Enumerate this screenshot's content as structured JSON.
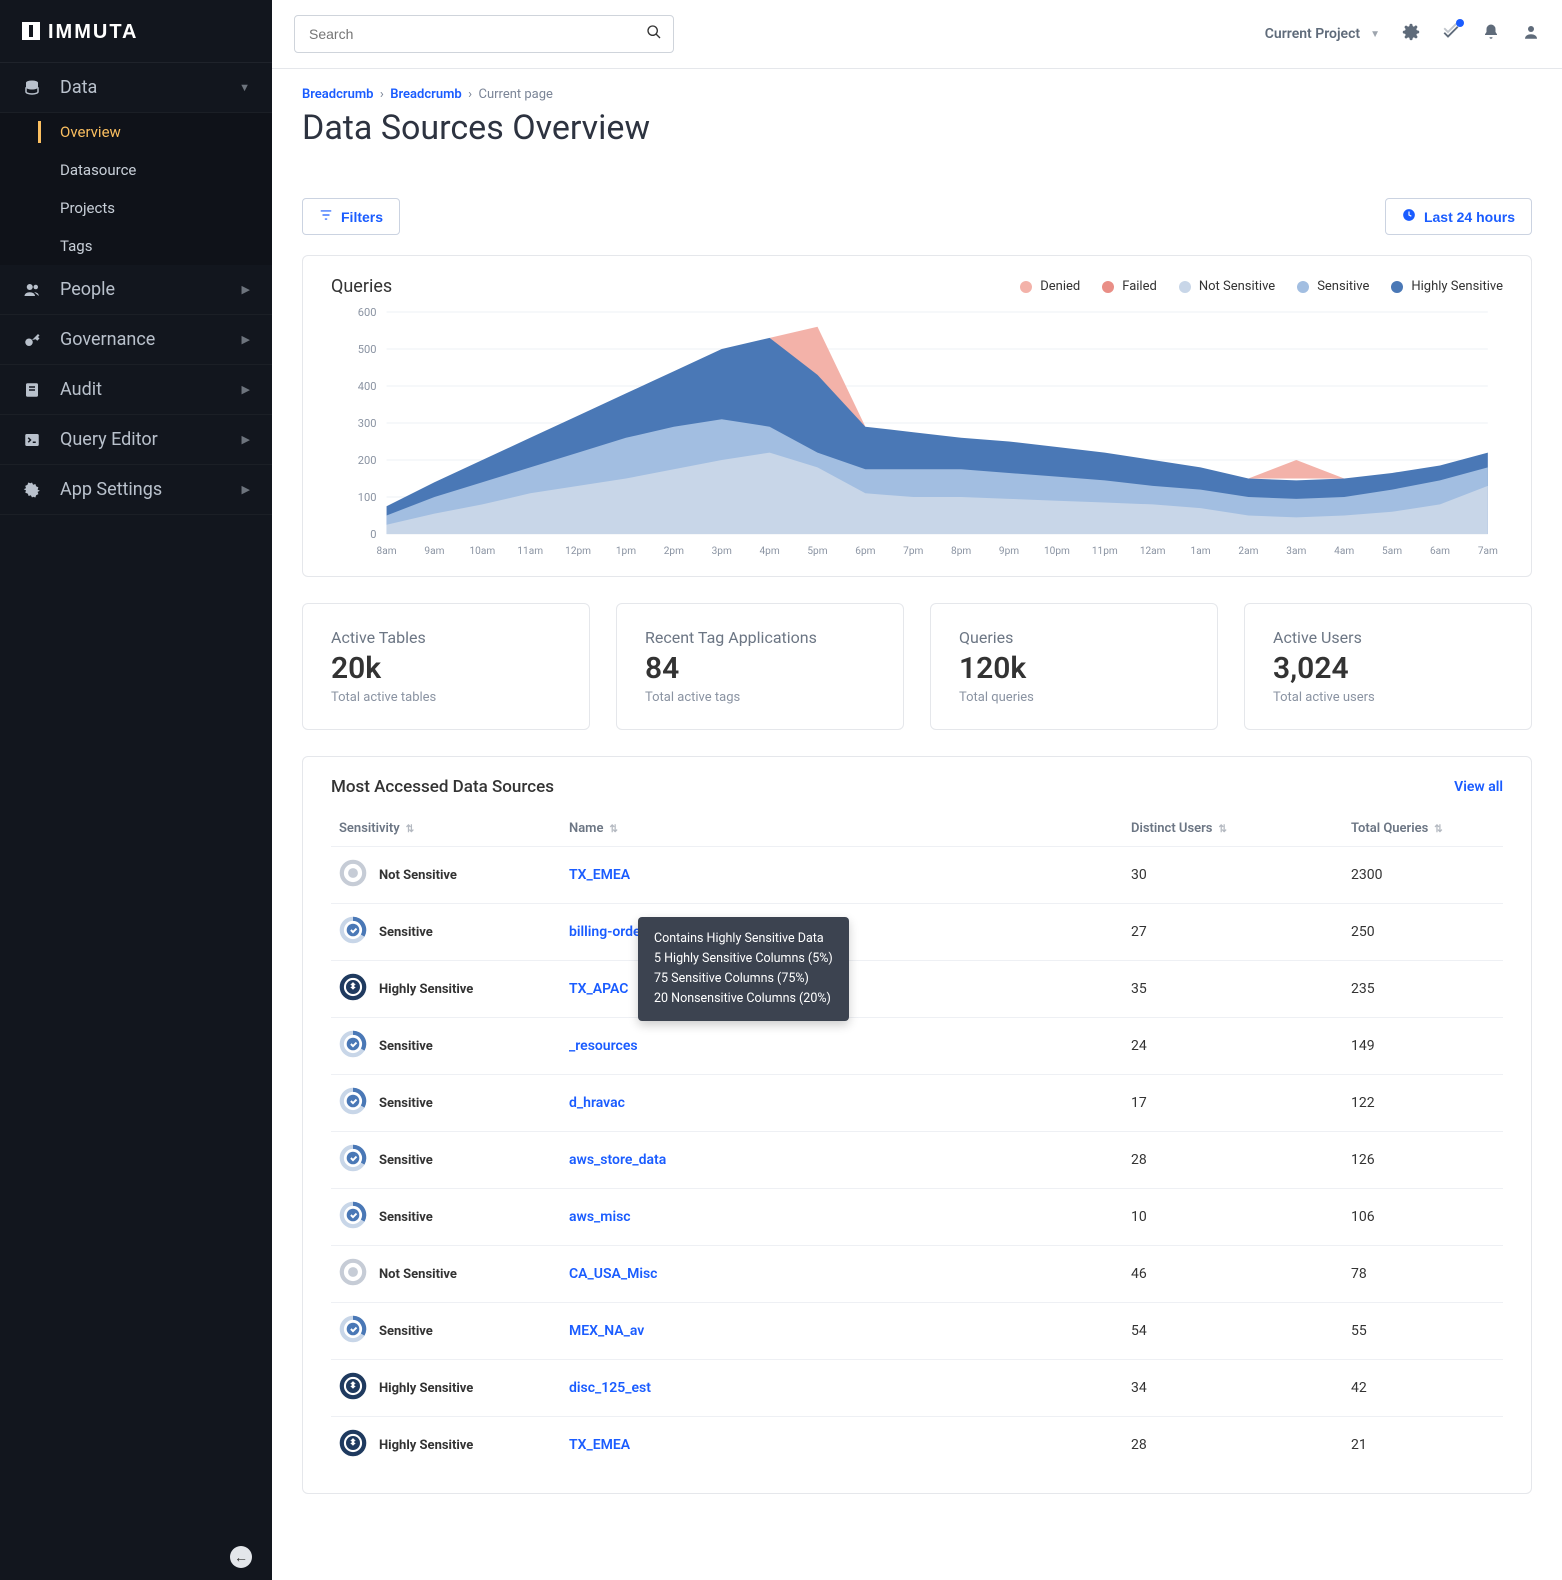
{
  "app_name": "IMMUTA",
  "search_placeholder": "Search",
  "topbar": {
    "project_label": "Current Project"
  },
  "sidebar": {
    "data": {
      "label": "Data",
      "items": [
        {
          "label": "Overview"
        },
        {
          "label": "Datasource"
        },
        {
          "label": "Projects"
        },
        {
          "label": "Tags"
        }
      ]
    },
    "people": {
      "label": "People"
    },
    "governance": {
      "label": "Governance"
    },
    "audit": {
      "label": "Audit"
    },
    "queryeditor": {
      "label": "Query Editor"
    },
    "appsettings": {
      "label": "App Settings"
    }
  },
  "breadcrumbs": {
    "a": "Breadcrumb",
    "b": "Breadcrumb",
    "c": "Current page"
  },
  "page_title": "Data Sources Overview",
  "toolbar": {
    "filters": "Filters",
    "timerange": "Last 24 hours"
  },
  "chart": {
    "title": "Queries",
    "legend": {
      "denied": "Denied",
      "failed": "Failed",
      "notsensitive": "Not Sensitive",
      "sensitive": "Sensitive",
      "highlysensitive": "Highly Sensitive"
    },
    "colors": {
      "denied": "#F3B2A9",
      "failed": "#E98E86",
      "notsensitive": "#C8D6E8",
      "sensitive": "#A2BEE1",
      "highlysensitive": "#4A78B6"
    }
  },
  "chart_data": {
    "type": "area",
    "title": "Queries",
    "ylabel": "",
    "ylim": [
      0,
      600
    ],
    "yticks": [
      0,
      100,
      200,
      300,
      400,
      500,
      600
    ],
    "categories": [
      "8am",
      "9am",
      "10am",
      "11am",
      "12pm",
      "1pm",
      "2pm",
      "3pm",
      "4pm",
      "5pm",
      "6pm",
      "7pm",
      "8pm",
      "9pm",
      "10pm",
      "11pm",
      "12am",
      "1am",
      "2am",
      "3am",
      "4am",
      "5am",
      "6am",
      "7am"
    ],
    "series": [
      {
        "name": "Not Sensitive",
        "color": "#C8D6E8",
        "values": [
          25,
          55,
          80,
          110,
          130,
          150,
          175,
          200,
          220,
          180,
          110,
          100,
          100,
          95,
          90,
          85,
          80,
          70,
          50,
          45,
          50,
          60,
          80,
          130
        ]
      },
      {
        "name": "Sensitive",
        "color": "#A2BEE1",
        "values": [
          50,
          100,
          140,
          180,
          220,
          260,
          290,
          310,
          290,
          220,
          175,
          175,
          175,
          165,
          155,
          145,
          130,
          120,
          100,
          95,
          100,
          120,
          145,
          180
        ]
      },
      {
        "name": "Highly Sensitive",
        "color": "#4A78B6",
        "values": [
          75,
          140,
          200,
          260,
          320,
          380,
          440,
          500,
          530,
          430,
          290,
          275,
          260,
          250,
          235,
          220,
          200,
          180,
          150,
          145,
          150,
          165,
          185,
          220
        ]
      },
      {
        "name": "Failed",
        "color": "#E98E86",
        "values": [
          0,
          0,
          0,
          0,
          0,
          0,
          0,
          0,
          530,
          560,
          290,
          0,
          0,
          0,
          0,
          0,
          0,
          0,
          165,
          200,
          165,
          0,
          0,
          0
        ],
        "peaks": [
          {
            "x": 9,
            "y": 560
          },
          {
            "x": 19,
            "y": 200
          }
        ]
      }
    ]
  },
  "stats": [
    {
      "title": "Active Tables",
      "value": "20k",
      "sub": "Total active tables"
    },
    {
      "title": "Recent Tag Applications",
      "value": "84",
      "sub": "Total active tags"
    },
    {
      "title": "Queries",
      "value": "120k",
      "sub": "Total queries"
    },
    {
      "title": "Active Users",
      "value": "3,024",
      "sub": "Total active users"
    }
  ],
  "table": {
    "title": "Most Accessed Data Sources",
    "viewall": "View all",
    "columns": {
      "sensitivity": "Sensitivity",
      "name": "Name",
      "users": "Distinct Users",
      "queries": "Total Queries"
    },
    "rows": [
      {
        "sens": "Not Sensitive",
        "kind": "none",
        "name": "TX_EMEA",
        "users": 30,
        "queries": 2300
      },
      {
        "sens": "Sensitive",
        "kind": "sens",
        "name": "billing-orders",
        "users": 27,
        "queries": 250
      },
      {
        "sens": "Highly Sensitive",
        "kind": "high",
        "name": "TX_APAC",
        "users": 35,
        "queries": 235
      },
      {
        "sens": "Sensitive",
        "kind": "sens",
        "name": "_resources",
        "users": 24,
        "queries": 149
      },
      {
        "sens": "Sensitive",
        "kind": "sens",
        "name": "d_hravac",
        "users": 17,
        "queries": 122
      },
      {
        "sens": "Sensitive",
        "kind": "sens",
        "name": "aws_store_data",
        "users": 28,
        "queries": 126
      },
      {
        "sens": "Sensitive",
        "kind": "sens",
        "name": "aws_misc",
        "users": 10,
        "queries": 106
      },
      {
        "sens": "Not Sensitive",
        "kind": "none",
        "name": "CA_USA_Misc",
        "users": 46,
        "queries": 78
      },
      {
        "sens": "Sensitive",
        "kind": "sens",
        "name": "MEX_NA_av",
        "users": 54,
        "queries": 55
      },
      {
        "sens": "Highly Sensitive",
        "kind": "high",
        "name": "disc_125_est",
        "users": 34,
        "queries": 42
      },
      {
        "sens": "Highly Sensitive",
        "kind": "high",
        "name": "TX_EMEA",
        "users": 28,
        "queries": 21
      }
    ]
  },
  "tooltip": {
    "lines": [
      "Contains Highly Sensitive Data",
      "5 Highly Sensitive Columns (5%)",
      "75 Sensitive Columns (75%)",
      "20 Nonsensitive Columns (20%)"
    ]
  }
}
